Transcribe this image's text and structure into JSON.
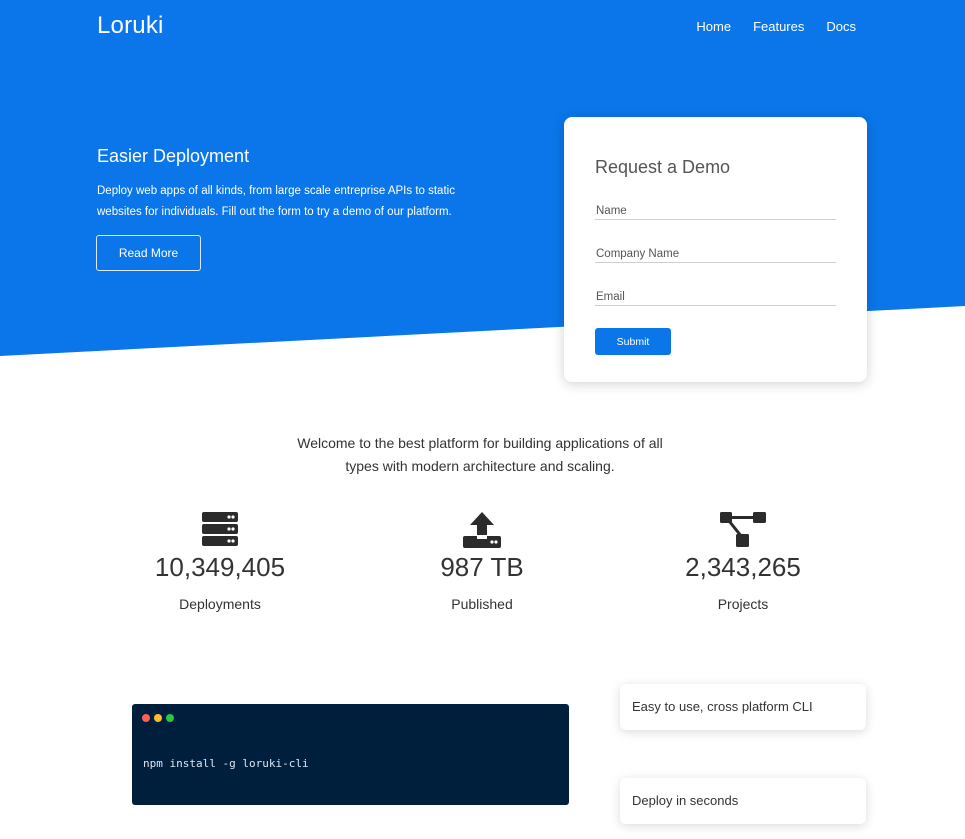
{
  "brand": {
    "name": "Loruki",
    "primary_color": "#0a76e9",
    "terminal_color": "#001f3d"
  },
  "nav": {
    "items": [
      "Home",
      "Features",
      "Docs"
    ]
  },
  "hero": {
    "title": "Easier Deployment",
    "text": "Deploy web apps of all kinds, from large scale entreprise APIs to static websites for individuals. Fill out the form to try a demo of our platform.",
    "button_label": "Read More"
  },
  "demo_form": {
    "title": "Request a Demo",
    "fields": [
      {
        "placeholder": "Name",
        "value": ""
      },
      {
        "placeholder": "Company Name",
        "value": ""
      },
      {
        "placeholder": "Email",
        "value": ""
      }
    ],
    "submit_label": "Submit"
  },
  "welcome": {
    "text": "Welcome to the best platform for building applications of all types with modern architecture and scaling."
  },
  "stats": [
    {
      "icon": "server-icon",
      "value": "10,349,405",
      "label": "Deployments"
    },
    {
      "icon": "upload-icon",
      "value": "987 TB",
      "label": "Published"
    },
    {
      "icon": "project-diagram-icon",
      "value": "2,343,265",
      "label": "Projects"
    }
  ],
  "terminal": {
    "command": "npm install -g loruki-cli"
  },
  "features": [
    {
      "text": "Easy to use, cross platform CLI"
    },
    {
      "text": "Deploy in seconds"
    }
  ]
}
